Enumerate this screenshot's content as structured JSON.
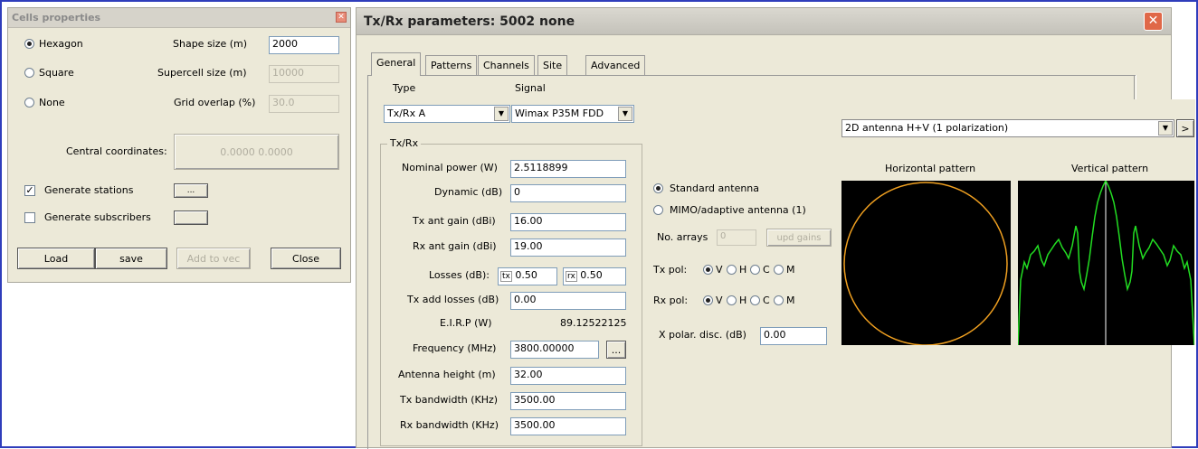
{
  "cells_window": {
    "title": "Cells properties",
    "shape_options": [
      {
        "label": "Hexagon",
        "selected": true
      },
      {
        "label": "Square",
        "selected": false
      },
      {
        "label": "None",
        "selected": false
      }
    ],
    "shape_size_label": "Shape size (m)",
    "shape_size_value": "2000",
    "supercell_label": "Supercell size (m)",
    "supercell_value": "10000",
    "grid_overlap_label": "Grid overlap (%)",
    "grid_overlap_value": "30.0",
    "central_label": "Central coordinates:",
    "central_value": "0.0000 0.0000",
    "generate_stations": {
      "label": "Generate stations",
      "checked": true,
      "button": "..."
    },
    "generate_subscribers": {
      "label": "Generate subscribers",
      "checked": false
    },
    "buttons": {
      "load": "Load",
      "save": "save",
      "add_to_vec": "Add to vec",
      "close": "Close"
    }
  },
  "txrx_window": {
    "title": "Tx/Rx parameters: 5002 none",
    "tabs": [
      "General",
      "Patterns",
      "Channels",
      "Site",
      "Advanced"
    ],
    "active_tab": "General",
    "type_label": "Type",
    "type_value": "Tx/Rx A",
    "signal_label": "Signal",
    "signal_value": "Wimax P35M FDD",
    "group_title": "Tx/Rx",
    "fields": {
      "nominal_power": {
        "label": "Nominal power (W)",
        "value": "2.5118899"
      },
      "dynamic": {
        "label": "Dynamic (dB)",
        "value": "0"
      },
      "tx_ant_gain": {
        "label": "Tx ant gain (dBi)",
        "value": "16.00"
      },
      "rx_ant_gain": {
        "label": "Rx ant gain (dBi)",
        "value": "19.00"
      },
      "losses": {
        "label": "Losses (dB):",
        "tx_tag": "tx",
        "tx_value": "0.50",
        "rx_tag": "rx",
        "rx_value": "0.50"
      },
      "tx_add_losses": {
        "label": "Tx add losses (dB)",
        "value": "0.00"
      },
      "eirp": {
        "label": "E.I.R.P (W)",
        "value": "89.12522125"
      },
      "frequency": {
        "label": "Frequency (MHz)",
        "value": "3800.00000",
        "button": "..."
      },
      "antenna_height": {
        "label": "Antenna height (m)",
        "value": "32.00"
      },
      "tx_bandwidth": {
        "label": "Tx bandwidth (KHz)",
        "value": "3500.00"
      },
      "rx_bandwidth": {
        "label": "Rx bandwidth (KHz)",
        "value": "3500.00"
      }
    }
  },
  "antenna_panel": {
    "standard_antenna": "Standard antenna",
    "mimo_antenna": "MIMO/adaptive antenna (1)",
    "no_arrays_label": "No. arrays",
    "no_arrays_value": "0",
    "upd_gains": "upd gains",
    "tx_pol": {
      "label": "Tx pol:",
      "options": [
        "V",
        "H",
        "C",
        "M"
      ],
      "selected": "V"
    },
    "rx_pol": {
      "label": "Rx pol:",
      "options": [
        "V",
        "H",
        "C",
        "M"
      ],
      "selected": "V"
    },
    "x_polar_label": "X polar. disc. (dB)",
    "x_polar_value": "0.00",
    "pattern_select": "2D antenna H+V (1 polarization)",
    "next_button": ">",
    "horizontal_title": "Horizontal pattern",
    "vertical_title": "Vertical pattern"
  },
  "colors": {
    "frame": "#2f3dbb",
    "titlebar": "#c9c7c0",
    "horizontal_pattern": "#f0a020",
    "vertical_pattern": "#22dd22"
  }
}
